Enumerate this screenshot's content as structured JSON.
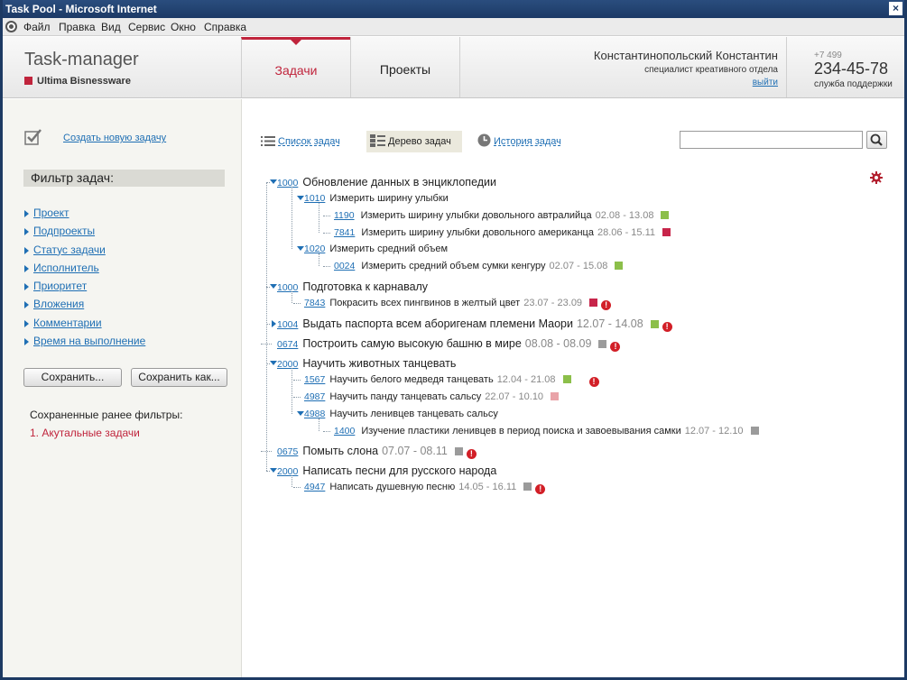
{
  "window": {
    "title": "Task Pool - Microsoft Internet",
    "close": "×"
  },
  "menu": [
    "Файл",
    "Правка",
    "Вид",
    "Сервис",
    "Окно",
    "Справка"
  ],
  "header": {
    "app_title": "Task-manager",
    "brand": "Ultima Bisnessware",
    "tabs": [
      "Задачи",
      "Проекты"
    ],
    "active_tab": "Задачи",
    "user_name": "Константинопольский Константин",
    "user_role": "специалист креативного отдела",
    "logout": "выйти",
    "phone_prefix": "+7 499",
    "phone": "234-45-78",
    "support": "служба поддержки"
  },
  "sidebar": {
    "create_task": "Создать новую задачу",
    "filter_title": "Фильтр задач:",
    "filters": [
      "Проект",
      "Подпроекты",
      "Статус задачи",
      "Исполнитель",
      "Приоритет",
      "Вложения",
      "Комментарии",
      "Время на выполнение"
    ],
    "save": "Сохранить...",
    "save_as": "Сохранить как...",
    "saved_title": "Сохраненные ранее фильтры:",
    "saved_items": [
      "1. Акутальные задачи"
    ]
  },
  "main": {
    "views": [
      "Список задач",
      "Дерево задач",
      "История задач"
    ],
    "active_view": "Дерево задач",
    "search_value": ""
  },
  "colors": {
    "accent": "#c0243c",
    "link": "#1f6fb4",
    "green": "#8cbf4a",
    "crimson": "#c7254a",
    "pink": "#e9a3a8",
    "gray": "#9b9b9b",
    "alert": "#d21f27"
  },
  "tasks": [
    {
      "id": "1000",
      "title": "Обновление данных в энциклопедии",
      "expanded": true,
      "children": [
        {
          "id": "1010",
          "title": "Измерить ширину улыбки",
          "expanded": true,
          "children": [
            {
              "id": "1190",
              "title": "Измерить ширину улыбки довольного автралийца",
              "dates": "02.08 - 13.08",
              "status": "green"
            },
            {
              "id": "7841",
              "title": "Измерить ширину улыбки довольного американца",
              "dates": "28.06 - 15.11",
              "status": "crimson"
            }
          ]
        },
        {
          "id": "1020",
          "title": "Измерить средний объем",
          "expanded": true,
          "children": [
            {
              "id": "0024",
              "title": "Измерить средний объем сумки кенгуру",
              "dates": "02.07 - 15.08",
              "status": "green"
            }
          ]
        }
      ]
    },
    {
      "id": "1000",
      "title": "Подготовка к карнавалу",
      "expanded": true,
      "children": [
        {
          "id": "7843",
          "title": "Покрасить всех пингвинов в желтый цвет",
          "dates": "23.07 - 23.09",
          "status": "crimson",
          "alert": "!"
        }
      ]
    },
    {
      "id": "1004",
      "title": "Выдать паспорта всем аборигенам племени Маори",
      "dates": "12.07 - 14.08",
      "status": "green",
      "alert": "!",
      "collapsed": true
    },
    {
      "id": "0674",
      "title": "Построить самую высокую башню в мире",
      "dates": "08.08 - 08.09",
      "status": "gray",
      "alert": "!"
    },
    {
      "id": "2000",
      "title": "Научить животных танцевать",
      "expanded": true,
      "children": [
        {
          "id": "1567",
          "title": "Научить белого медведя танцевать",
          "dates": "12.04 - 21.08",
          "status": "green",
          "alert": "!"
        },
        {
          "id": "4987",
          "title": "Научить панду танцевать сальсу",
          "dates": "22.07 - 10.10",
          "status": "pink"
        },
        {
          "id": "4988",
          "title": "Научить ленивцев танцевать сальсу",
          "expanded": true,
          "children": [
            {
              "id": "1400",
              "title": "Изучение пластики ленивцев в период поиска и завоевывания самки",
              "dates": "12.07 - 12.10",
              "status": "gray"
            }
          ]
        }
      ]
    },
    {
      "id": "0675",
      "title": "Помыть слона",
      "dates": "07.07 - 08.11",
      "status": "gray",
      "alert": "!"
    },
    {
      "id": "2000",
      "title": "Написать песни для русского народа",
      "expanded": true,
      "children": [
        {
          "id": "4947",
          "title": "Написать душевную песню",
          "dates": "14.05 - 16.11",
          "status": "gray",
          "alert": "!"
        }
      ]
    }
  ]
}
